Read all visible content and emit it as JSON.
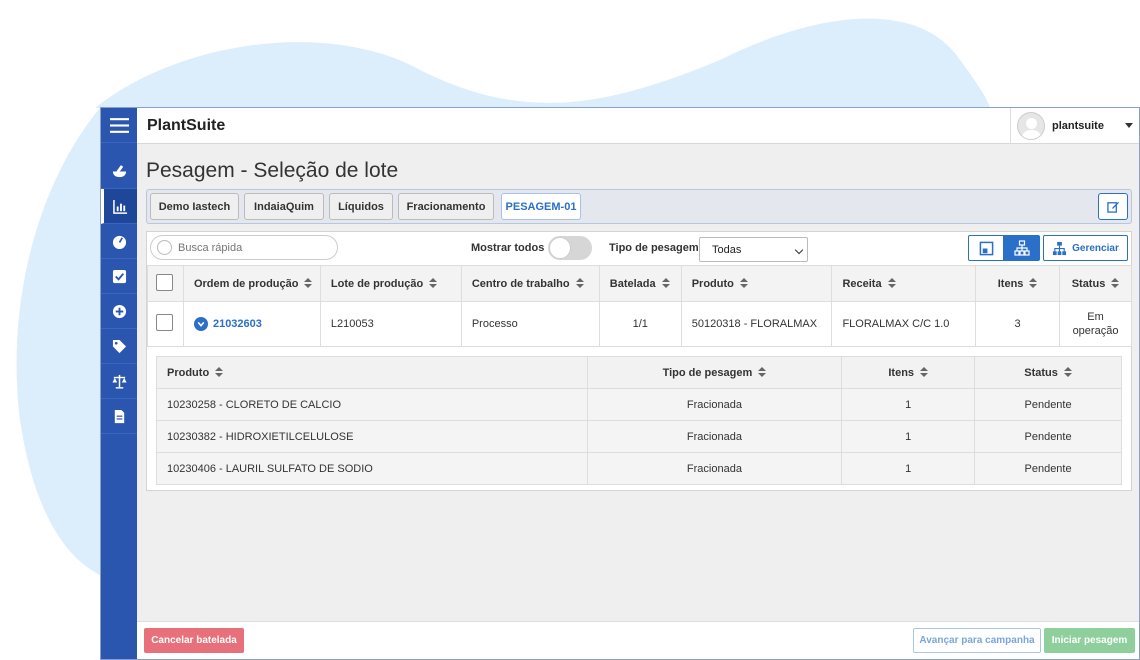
{
  "app": {
    "brand": "PlantSuite"
  },
  "user": {
    "name": "plantsuite"
  },
  "sidebar": {
    "menu_icon": "hamburger-icon",
    "items": [
      {
        "icon": "mortar-pestle-icon",
        "active": false
      },
      {
        "icon": "chart-icon",
        "active": true
      },
      {
        "icon": "gauge-icon",
        "active": false
      },
      {
        "icon": "checkbox-icon",
        "active": false
      },
      {
        "icon": "plus-circle-icon",
        "active": false
      },
      {
        "icon": "tag-icon",
        "active": false
      },
      {
        "icon": "scale-icon",
        "active": false
      },
      {
        "icon": "document-icon",
        "active": false
      }
    ]
  },
  "page": {
    "title": "Pesagem - Seleção de lote"
  },
  "breadcrumb": [
    "Demo Iastech",
    "IndaiaQuim",
    "Líquidos",
    "Fracionamento",
    "PESAGEM-01"
  ],
  "toolbar": {
    "search_placeholder": "Busca rápida",
    "show_all_label": "Mostrar todos",
    "weighing_type_label": "Tipo de pesagem",
    "weighing_type_value": "Todas",
    "manage_label": "Gerenciar"
  },
  "table": {
    "headers": [
      "Ordem de produção",
      "Lote de produção",
      "Centro de trabalho",
      "Batelada",
      "Produto",
      "Receita",
      "Itens",
      "Status"
    ],
    "rows": [
      {
        "order": "21032603",
        "lot": "L210053",
        "work_center": "Processo",
        "batch": "1/1",
        "product": "50120318 - FLORALMAX",
        "recipe": "FLORALMAX C/C 1.0",
        "items": "3",
        "status": "Em operação"
      }
    ]
  },
  "subtable": {
    "headers": [
      "Produto",
      "Tipo de pesagem",
      "Itens",
      "Status"
    ],
    "rows": [
      {
        "product": "10230258 - CLORETO DE CALCIO",
        "type": "Fracionada",
        "items": "1",
        "status": "Pendente"
      },
      {
        "product": "10230382 - HIDROXIETILCELULOSE",
        "type": "Fracionada",
        "items": "1",
        "status": "Pendente"
      },
      {
        "product": "10230406 - LAURIL SULFATO DE SODIO",
        "type": "Fracionada",
        "items": "1",
        "status": "Pendente"
      }
    ]
  },
  "footer": {
    "cancel_label": "Cancelar batelada",
    "advance_label": "Avançar para campanha",
    "start_label": "Iniciar pesagem"
  },
  "colors": {
    "sidebar": "#2a56b0",
    "accent": "#2a6fc8",
    "cancel": "#e8707a",
    "start": "#8fcf9c",
    "blob": "#dcedfb"
  }
}
